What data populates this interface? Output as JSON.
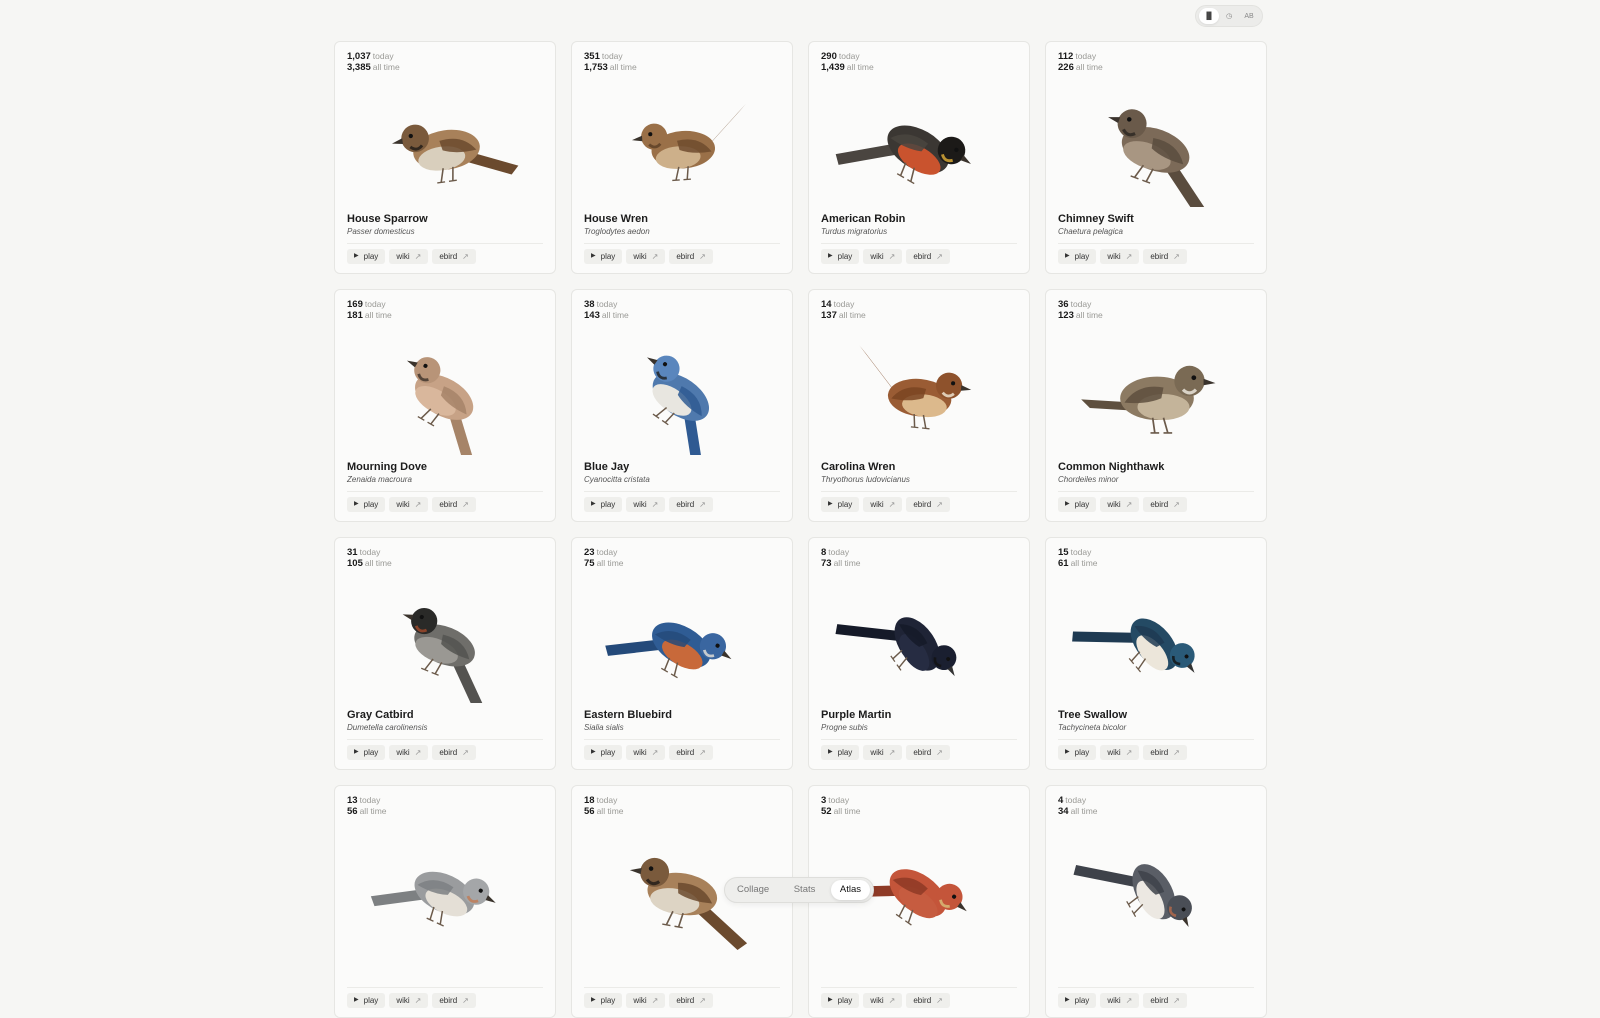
{
  "toolbar": {
    "sort_options": [
      {
        "icon": "bar-chart-icon",
        "glyph": "▐▌",
        "active": true
      },
      {
        "icon": "clock-icon",
        "glyph": "◷",
        "active": false
      },
      {
        "icon": "alphabetical-icon",
        "glyph": "AB",
        "active": false
      }
    ]
  },
  "labels": {
    "today": "today",
    "all_time": "all time",
    "play": "play",
    "wiki": "wiki",
    "ebird": "ebird"
  },
  "birds": [
    {
      "today": "1,037",
      "all_time": "3,385",
      "name": "House Sparrow",
      "sci": "Passer domesticus",
      "colors": {
        "body": "#a8815a",
        "belly": "#d9cfbd",
        "head": "#7a5a3c",
        "accent": "#1f1a16",
        "wing": "#6b4a2e"
      }
    },
    {
      "today": "351",
      "all_time": "1,753",
      "name": "House Wren",
      "sci": "Troglodytes aedon",
      "colors": {
        "body": "#9a7048",
        "belly": "#cdb08a",
        "head": "#9a7048",
        "accent": "#5a3e26",
        "wing": "#6e4b2e"
      }
    },
    {
      "today": "290",
      "all_time": "1,439",
      "name": "American Robin",
      "sci": "Turdus migratorius",
      "colors": {
        "body": "#3b3733",
        "belly": "#c9532e",
        "head": "#1c1a18",
        "accent": "#e2b03a",
        "wing": "#4a4540"
      }
    },
    {
      "today": "112",
      "all_time": "226",
      "name": "Chimney Swift",
      "sci": "Chaetura pelagica",
      "colors": {
        "body": "#7c6a58",
        "belly": "#a89682",
        "head": "#6a5a4a",
        "accent": "#2b2520",
        "wing": "#5a4c3e"
      }
    },
    {
      "today": "169",
      "all_time": "181",
      "name": "Mourning Dove",
      "sci": "Zenaida macroura",
      "colors": {
        "body": "#c7a286",
        "belly": "#d9b79c",
        "head": "#b89478",
        "accent": "#3b2f28",
        "wing": "#a68468"
      }
    },
    {
      "today": "38",
      "all_time": "143",
      "name": "Blue Jay",
      "sci": "Cyanocitta cristata",
      "colors": {
        "body": "#4f79ad",
        "belly": "#e8e6e0",
        "head": "#5a86bd",
        "accent": "#1d1d1d",
        "wing": "#2f5a92"
      }
    },
    {
      "today": "14",
      "all_time": "137",
      "name": "Carolina Wren",
      "sci": "Thryothorus ludovicianus",
      "colors": {
        "body": "#9a5c34",
        "belly": "#dcb98c",
        "head": "#8e522c",
        "accent": "#f2ead8",
        "wing": "#7a4422"
      }
    },
    {
      "today": "36",
      "all_time": "123",
      "name": "Common Nighthawk",
      "sci": "Chordeiles minor",
      "colors": {
        "body": "#8c7a62",
        "belly": "#c4b49a",
        "head": "#7a6a54",
        "accent": "#f1ece2",
        "wing": "#5e4f3e"
      }
    },
    {
      "today": "31",
      "all_time": "105",
      "name": "Gray Catbird",
      "sci": "Dumetella carolinensis",
      "colors": {
        "body": "#6f6e6a",
        "belly": "#9a9893",
        "head": "#2a2a28",
        "accent": "#a24a2a",
        "wing": "#545350"
      }
    },
    {
      "today": "23",
      "all_time": "75",
      "name": "Eastern Bluebird",
      "sci": "Sialia sialis",
      "colors": {
        "body": "#2f5c94",
        "belly": "#c8693a",
        "head": "#3a66a0",
        "accent": "#eae4d8",
        "wing": "#244a7a"
      }
    },
    {
      "today": "8",
      "all_time": "73",
      "name": "Purple Martin",
      "sci": "Progne subis",
      "colors": {
        "body": "#1f2436",
        "belly": "#262c42",
        "head": "#1a1f30",
        "accent": "#111",
        "wing": "#151a28"
      }
    },
    {
      "today": "15",
      "all_time": "61",
      "name": "Tree Swallow",
      "sci": "Tachycineta bicolor",
      "colors": {
        "body": "#244a64",
        "belly": "#ece6da",
        "head": "#2a5a78",
        "accent": "#111",
        "wing": "#1e3a52"
      }
    },
    {
      "today": "13",
      "all_time": "56",
      "name": "",
      "sci": "",
      "colors": {
        "body": "#9a9c9e",
        "belly": "#e4dfd6",
        "head": "#a4a6a8",
        "accent": "#c27a52",
        "wing": "#7d8082"
      }
    },
    {
      "today": "18",
      "all_time": "56",
      "name": "",
      "sci": "",
      "colors": {
        "body": "#a8815a",
        "belly": "#ddd4c4",
        "head": "#7a5a3c",
        "accent": "#1f1a16",
        "wing": "#6b4a2e"
      }
    },
    {
      "today": "3",
      "all_time": "52",
      "name": "",
      "sci": "",
      "colors": {
        "body": "#c4553a",
        "belly": "#c65c40",
        "head": "#c4553a",
        "accent": "#d8c07a",
        "wing": "#8e3a26"
      }
    },
    {
      "today": "4",
      "all_time": "34",
      "name": "",
      "sci": "",
      "colors": {
        "body": "#5a5e66",
        "belly": "#ece8e2",
        "head": "#4a4e56",
        "accent": "#b86a4a",
        "wing": "#3e424a"
      }
    }
  ],
  "view_switch": {
    "tabs": [
      {
        "label": "Collage",
        "active": false
      },
      {
        "label": "Stats",
        "active": false
      },
      {
        "label": "Atlas",
        "active": true
      }
    ]
  }
}
